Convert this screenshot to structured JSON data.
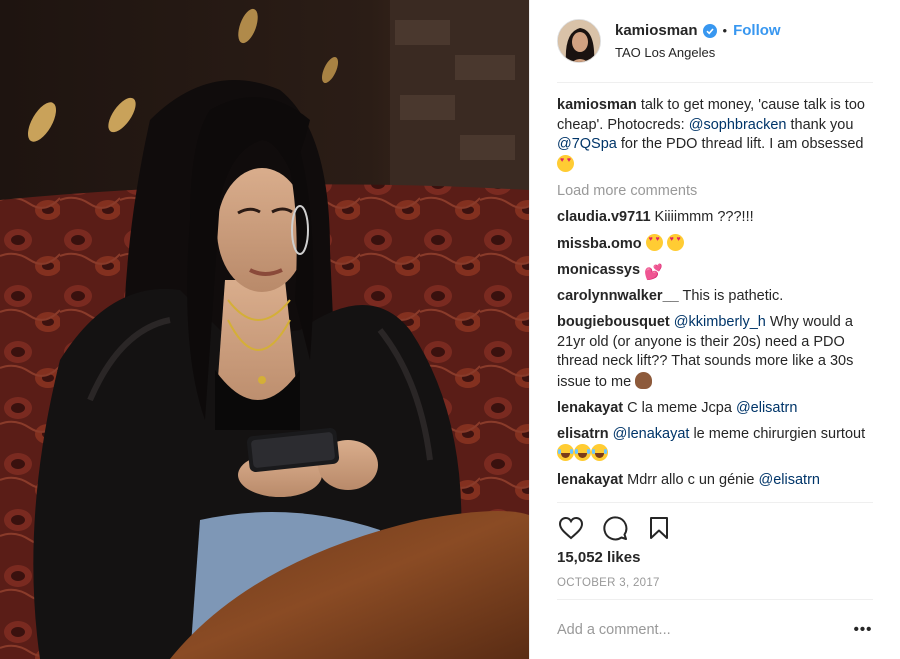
{
  "post": {
    "username": "kamiosman",
    "follow_label": "Follow",
    "location": "TAO Los Angeles",
    "caption": {
      "user": "kamiosman",
      "text_1": " talk to get money, 'cause talk is too cheap'. Photocreds: ",
      "mention_1": "@sophbracken",
      "text_2": " thank you ",
      "mention_2": "@7QSpa",
      "text_3": " for the PDO thread lift. I am obsessed "
    },
    "load_more_label": "Load more comments",
    "comments": [
      {
        "user": "claudia.v9711",
        "text": " Kiiiimmm ???!!!"
      },
      {
        "user": "missba.omo",
        "text": " "
      },
      {
        "user": "monicassys",
        "text": " "
      },
      {
        "user": "carolynnwalker__",
        "text": " This is pathetic."
      },
      {
        "user": "bougiebousquet",
        "mention": "@kkimberly_h",
        "text": " Why would a 21yr old (or anyone is their 20s) need a PDO thread neck lift?? That sounds more like a 30s issue to me "
      },
      {
        "user": "lenakayat",
        "text": " C la meme Jcpa ",
        "mention": "@elisatrn"
      },
      {
        "user": "elisatrn",
        "mention": "@lenakayat",
        "text": " le meme chirurgien surtout "
      },
      {
        "user": "lenakayat",
        "text": " Mdrr allo c un génie ",
        "mention": "@elisatrn"
      }
    ],
    "likes": "15,052 likes",
    "date": "OCTOBER 3, 2017",
    "add_comment_placeholder": "Add a comment...",
    "more_label": "•••"
  },
  "icons": {
    "verified": "verified-badge-icon",
    "like": "heart-outline-icon",
    "comment": "speech-bubble-icon",
    "save": "bookmark-icon",
    "more": "ellipsis-icon"
  },
  "colors": {
    "link_blue": "#3897f0",
    "mention_blue": "#003569",
    "muted": "#999999",
    "text": "#262626"
  }
}
